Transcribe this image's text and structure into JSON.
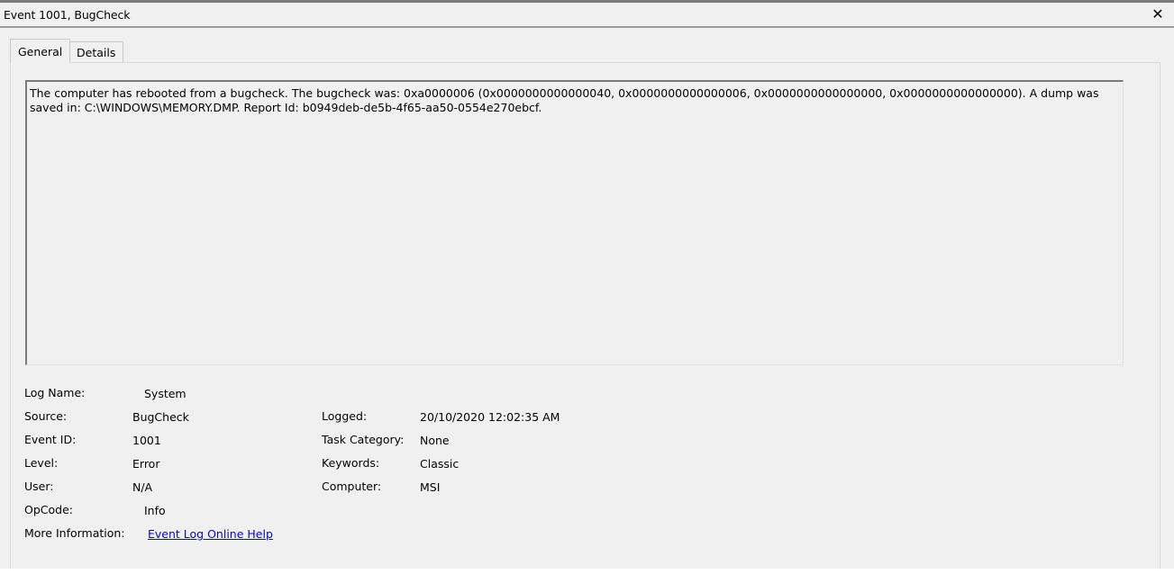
{
  "window": {
    "title": "Event 1001, BugCheck",
    "close_glyph": "✕"
  },
  "tabs": [
    {
      "label": "General",
      "active": true
    },
    {
      "label": "Details",
      "active": false
    }
  ],
  "description": "The computer has rebooted from a bugcheck.  The bugcheck was: 0xa0000006 (0x0000000000000040, 0x0000000000000006, 0x0000000000000000, 0x0000000000000000). A dump was saved in: C:\\WINDOWS\\MEMORY.DMP. Report Id: b0949deb-de5b-4f65-aa50-0554e270ebcf.",
  "properties": {
    "log_name": {
      "label": "Log Name:",
      "value": "System"
    },
    "source": {
      "label": "Source:",
      "value": "BugCheck"
    },
    "event_id": {
      "label": "Event ID:",
      "value": "1001"
    },
    "level": {
      "label": "Level:",
      "value": "Error"
    },
    "user": {
      "label": "User:",
      "value": "N/A"
    },
    "opcode": {
      "label": "OpCode:",
      "value": "Info"
    },
    "more_info": {
      "label": "More Information:",
      "value": "Event Log Online Help"
    },
    "logged": {
      "label": "Logged:",
      "value": "20/10/2020 12:02:35 AM"
    },
    "task_category": {
      "label": "Task Category:",
      "value": "None"
    },
    "keywords": {
      "label": "Keywords:",
      "value": "Classic"
    },
    "computer": {
      "label": "Computer:",
      "value": "MSI"
    }
  }
}
